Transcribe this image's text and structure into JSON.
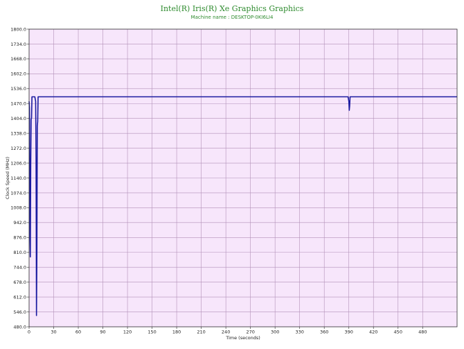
{
  "chart_data": {
    "type": "line",
    "title": "Intel(R) Iris(R) Xe Graphics Graphics",
    "subtitle": "Machine name : DESKTOP-0KI6LI4",
    "xlabel": "Time (seconds)",
    "ylabel": "Clock Speed (MHz)",
    "xlim": [
      0,
      522
    ],
    "ylim": [
      480.0,
      1800.0
    ],
    "x_ticks": [
      0,
      30,
      60,
      90,
      120,
      150,
      180,
      210,
      240,
      270,
      300,
      330,
      360,
      390,
      420,
      450,
      480
    ],
    "y_ticks": [
      "1800.0",
      "1734.0",
      "1668.0",
      "1602.0",
      "1536.0",
      "1470.0",
      "1404.0",
      "1338.0",
      "1272.0",
      "1206.0",
      "1140.0",
      "1074.0",
      "1008.0",
      "942.0",
      "876.0",
      "810.0",
      "744.0",
      "678.0",
      "612.0",
      "546.0",
      "480.0"
    ],
    "grid": true,
    "colors": {
      "background": "#f7e6fb",
      "grid": "#b290b8",
      "line": "#1a1aa0",
      "title": "#2e8b2e"
    },
    "series": [
      {
        "x": [
          0,
          0.5,
          1,
          1.5,
          2,
          2.5,
          3,
          3.5,
          4,
          5,
          6,
          7,
          8,
          8.5,
          9,
          9.5,
          10,
          10.5,
          11,
          12,
          13,
          15,
          20,
          50,
          100,
          200,
          300,
          389,
          390,
          390.5,
          391,
          391.5,
          392,
          393,
          400,
          450,
          522
        ],
        "y": [
          1480,
          1450,
          900,
          790,
          1200,
          1400,
          1405,
          1500,
          1500,
          1500,
          1500,
          1500,
          1480,
          1230,
          530,
          800,
          1370,
          1390,
          1500,
          1500,
          1500,
          1500,
          1500,
          1500,
          1500,
          1500,
          1500,
          1500,
          1480,
          1440,
          1460,
          1500,
          1500,
          1500,
          1500,
          1500,
          1500
        ]
      }
    ]
  }
}
